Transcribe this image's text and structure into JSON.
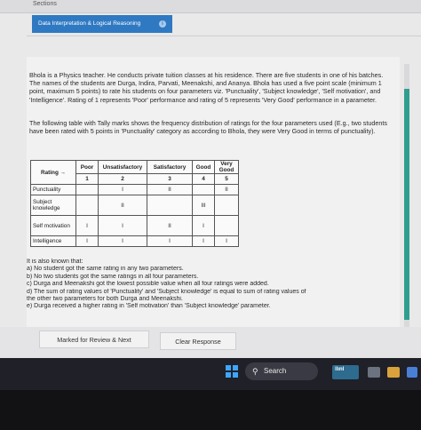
{
  "header": {
    "sections_label": "Sections",
    "section_tab": "Data Interpretation & Logical Reasoning",
    "info_symbol": "i"
  },
  "question": {
    "paragraph1": "Bhola is a Physics teacher. He conducts private tuition classes at his residence. There are five students in one of his batches. The names of the students are Durga, Indira, Parvati, Meenakshi, and Ananya. Bhola has used a five point scale (minimum 1 point, maximum 5 points) to rate his students on four parameters viz. 'Punctuality', 'Subject knowledge', 'Self motivation', and 'Intelligence'. Rating of 1 represents 'Poor' performance and rating of 5 represents 'Very Good' performance in a parameter.",
    "paragraph2": "The following table with Tally marks shows the frequency distribution of ratings for the four parameters used (E.g., two students have been rated with 5 points in 'Punctuality' category as according to Bhola, they were Very Good in terms of punctuality).",
    "table": {
      "rating_header": "Rating →",
      "columns": [
        "Poor",
        "Unsatisfactory",
        "Satisfactory",
        "Good",
        "Very Good"
      ],
      "points": [
        "1",
        "2",
        "3",
        "4",
        "5"
      ],
      "rows": [
        {
          "label": "Punctuality",
          "cells": [
            "",
            "I",
            "II",
            "",
            "II"
          ]
        },
        {
          "label": "Subject knowledge",
          "cells": [
            "",
            "II",
            "",
            "III",
            ""
          ]
        },
        {
          "label": "Self motivation",
          "cells": [
            "I",
            "I",
            "II",
            "I",
            ""
          ]
        },
        {
          "label": "Intelligence",
          "cells": [
            "I",
            "I",
            "I",
            "I",
            "I"
          ]
        }
      ]
    },
    "known_intro": "It is also known that:",
    "conditions": [
      "a) No student got the same rating in any two parameters.",
      "b) No two students got the same ratings in all four parameters.",
      "c) Durga and Meenakshi got the lowest possible value when all four ratings were added.",
      "d) The sum of rating values of 'Punctuality' and 'Subject knowledge' is equal to sum of rating values of",
      "the other two parameters for both Durga and Meenakshi.",
      "e) Durga received a higher rating in 'Self motivation' than 'Subject knowledge' parameter."
    ]
  },
  "footer": {
    "review_button": "Marked for Review & Next",
    "clear_button": "Clear Response"
  },
  "taskbar": {
    "search_label": "Search",
    "widget_label": "ǀlınl"
  },
  "colors": {
    "section_tab": "#2f79c2",
    "scrollbar": "#2f9e8f",
    "taskbar": "#202028"
  }
}
